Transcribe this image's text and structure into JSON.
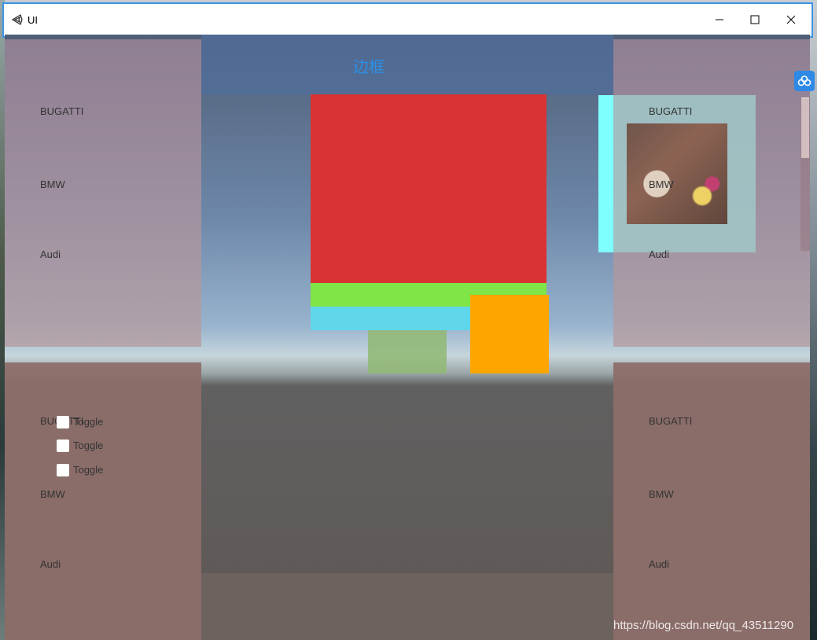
{
  "window": {
    "title": "UI"
  },
  "canvas": {
    "border_title": "边框",
    "top_left": [
      "BUGATTI",
      "BMW",
      "Audi"
    ],
    "top_right": [
      "BUGATTI",
      "BMW",
      "Audi"
    ],
    "bottom_left": [
      "BUGATTI",
      "BMW",
      "Audi"
    ],
    "bottom_right": [
      "BUGATTI",
      "BMW",
      "Audi"
    ],
    "toggles": [
      "Toggle",
      "Toggle",
      "Toggle"
    ]
  },
  "watermark": "https://blog.csdn.net/qq_43511290",
  "colors": {
    "red": "#d93434",
    "green": "#80e546",
    "cyan": "#60d6ea",
    "orange": "#ffa500",
    "title_accent": "#2b8fe6"
  }
}
